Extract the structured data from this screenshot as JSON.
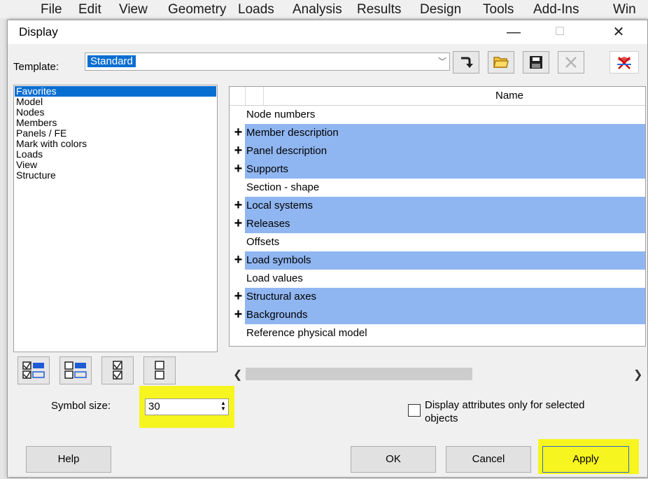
{
  "menubar": [
    "File",
    "Edit",
    "View",
    "Geometry",
    "Loads",
    "Analysis",
    "Results",
    "Design",
    "Tools",
    "Add-Ins",
    "Win"
  ],
  "dialog": {
    "title": "Display",
    "caption_buttons": {
      "minimize": "—",
      "maximize": "☐",
      "close": "✕"
    },
    "template": {
      "label": "Template:",
      "value": "Standard"
    },
    "categories": [
      "Favorites",
      "Model",
      "Nodes",
      "Members",
      "Panels / FE",
      "Mark with colors",
      "Loads",
      "View",
      "Structure"
    ],
    "selected_category": "Favorites",
    "grid": {
      "column_header": "Name",
      "rows": [
        {
          "label": "Node numbers",
          "expandable": false,
          "highlighted": false
        },
        {
          "label": "Member description",
          "expandable": true,
          "highlighted": true
        },
        {
          "label": "Panel description",
          "expandable": true,
          "highlighted": true
        },
        {
          "label": "Supports",
          "expandable": true,
          "highlighted": true
        },
        {
          "label": "Section - shape",
          "expandable": false,
          "highlighted": false
        },
        {
          "label": "Local systems",
          "expandable": true,
          "highlighted": true
        },
        {
          "label": "Releases",
          "expandable": true,
          "highlighted": true
        },
        {
          "label": "Offsets",
          "expandable": false,
          "highlighted": false
        },
        {
          "label": "Load symbols",
          "expandable": true,
          "highlighted": true
        },
        {
          "label": "Load values",
          "expandable": false,
          "highlighted": false
        },
        {
          "label": "Structural axes",
          "expandable": true,
          "highlighted": true
        },
        {
          "label": "Backgrounds",
          "expandable": true,
          "highlighted": true
        },
        {
          "label": "Reference physical model",
          "expandable": false,
          "highlighted": false
        }
      ]
    },
    "symbol_size": {
      "label": "Symbol size:",
      "value": "30"
    },
    "selected_only": {
      "label_line1": "Display attributes only for selected",
      "label_line2": "objects",
      "checked": false
    },
    "buttons": {
      "help": "Help",
      "ok": "OK",
      "cancel": "Cancel",
      "apply": "Apply"
    },
    "colors": {
      "selection": "#0a6ed1",
      "row_highlight": "#90b6f1",
      "annotation": "#f7f51f"
    }
  }
}
